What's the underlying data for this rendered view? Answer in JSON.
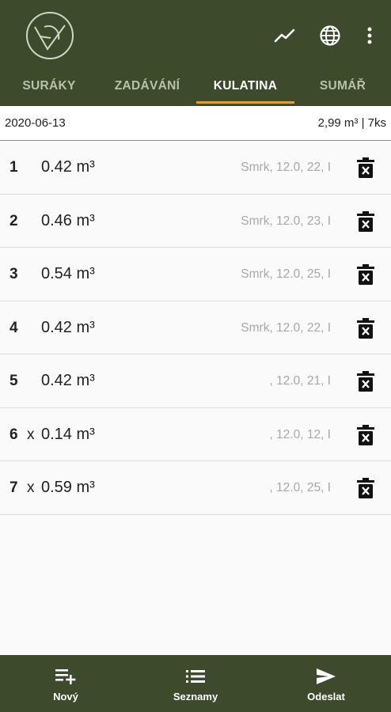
{
  "header": {
    "logo": "axe-log-logo",
    "actions": [
      {
        "name": "trend-chart-icon"
      },
      {
        "name": "globe-icon"
      },
      {
        "name": "more-vert-icon"
      }
    ]
  },
  "tabs": [
    {
      "label": "SURÁKY",
      "active": false
    },
    {
      "label": "ZADÁVÁNÍ",
      "active": false
    },
    {
      "label": "KULATINA",
      "active": true
    },
    {
      "label": "SUMÁŘ",
      "active": false
    }
  ],
  "info": {
    "date": "2020-06-13",
    "summary": "2,99 m³ | 7ks"
  },
  "rows": [
    {
      "num": "1",
      "mark": "",
      "volume": "0.42 m³",
      "detail": "Smrk, 12.0, 22, I"
    },
    {
      "num": "2",
      "mark": "",
      "volume": "0.46 m³",
      "detail": "Smrk, 12.0, 23, I"
    },
    {
      "num": "3",
      "mark": "",
      "volume": "0.54 m³",
      "detail": "Smrk, 12.0, 25, I"
    },
    {
      "num": "4",
      "mark": "",
      "volume": "0.42 m³",
      "detail": "Smrk, 12.0, 22, I"
    },
    {
      "num": "5",
      "mark": "",
      "volume": "0.42 m³",
      "detail": ", 12.0, 21, I"
    },
    {
      "num": "6",
      "mark": "x",
      "volume": "0.14 m³",
      "detail": ", 12.0, 12, I"
    },
    {
      "num": "7",
      "mark": "x",
      "volume": "0.59 m³",
      "detail": ", 12.0, 25, I"
    }
  ],
  "bottom_nav": [
    {
      "label": "Nový",
      "icon": "playlist-add-icon"
    },
    {
      "label": "Seznamy",
      "icon": "list-icon"
    },
    {
      "label": "Odeslat",
      "icon": "send-icon"
    }
  ],
  "colors": {
    "primary": "#3d4a2b",
    "accent": "#d9a23a"
  }
}
